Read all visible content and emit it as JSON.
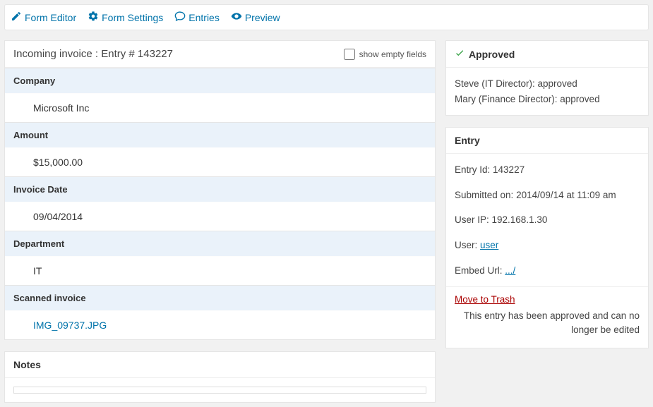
{
  "toolbar": {
    "form_editor": "Form Editor",
    "form_settings": "Form Settings",
    "entries": "Entries",
    "preview": "Preview"
  },
  "entry_header": {
    "title": "Incoming invoice : Entry # 143227",
    "show_empty_label": "show empty fields"
  },
  "fields": {
    "company_label": "Company",
    "company_value": "Microsoft Inc",
    "amount_label": "Amount",
    "amount_value": "$15,000.00",
    "invoice_date_label": "Invoice Date",
    "invoice_date_value": "09/04/2014",
    "department_label": "Department",
    "department_value": "IT",
    "scanned_label": "Scanned invoice",
    "scanned_value": "IMG_09737.JPG"
  },
  "notes": {
    "title": "Notes"
  },
  "approved_box": {
    "title": "Approved",
    "line1": "Steve (IT Director): approved",
    "line2": "Mary (Finance Director): approved"
  },
  "entry_meta": {
    "title": "Entry",
    "id_label": "Entry Id: ",
    "id_value": "143227",
    "submitted_label": "Submitted on: ",
    "submitted_value": "2014/09/14 at 11:09 am",
    "ip_label": "User IP: ",
    "ip_value": "192.168.1.30",
    "user_label": "User: ",
    "user_value": "user",
    "embed_label": "Embed Url: ",
    "embed_value": ".../",
    "trash": "Move to Trash",
    "approved_note": "This entry has been approved and can no longer be edited"
  }
}
